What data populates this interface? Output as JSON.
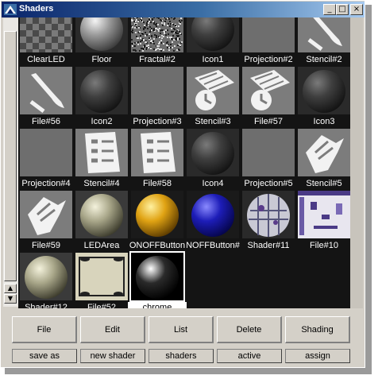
{
  "window": {
    "title": "Shaders"
  },
  "window_controls": {
    "minimize": "_",
    "maximize": "□",
    "close": "×"
  },
  "shaders": [
    {
      "label": "ClearLED",
      "kind": "checker"
    },
    {
      "label": "Floor",
      "kind": "sphere-gray"
    },
    {
      "label": "Fractal#2",
      "kind": "noise"
    },
    {
      "label": "Icon1",
      "kind": "sphere-dark"
    },
    {
      "label": "Projection#2",
      "kind": "flat-gray"
    },
    {
      "label": "Stencil#2",
      "kind": "stencil-pen"
    },
    {
      "label": "File#56",
      "kind": "stencil-pen"
    },
    {
      "label": "Icon2",
      "kind": "sphere-dark"
    },
    {
      "label": "Projection#3",
      "kind": "flat-gray"
    },
    {
      "label": "Stencil#3",
      "kind": "stencil-clock"
    },
    {
      "label": "File#57",
      "kind": "stencil-clock"
    },
    {
      "label": "Icon3",
      "kind": "sphere-dark"
    },
    {
      "label": "Projection#4",
      "kind": "flat-gray"
    },
    {
      "label": "Stencil#4",
      "kind": "stencil-list"
    },
    {
      "label": "File#58",
      "kind": "stencil-list"
    },
    {
      "label": "Icon4",
      "kind": "sphere-dark"
    },
    {
      "label": "Projection#5",
      "kind": "flat-gray"
    },
    {
      "label": "Stencil#5",
      "kind": "stencil-hand"
    },
    {
      "label": "File#59",
      "kind": "stencil-hand"
    },
    {
      "label": "LEDArea",
      "kind": "sphere-cream"
    },
    {
      "label": "ONOFFButton",
      "kind": "sphere-gold"
    },
    {
      "label": "NOFFButton#",
      "kind": "sphere-blue"
    },
    {
      "label": "Shader#11",
      "kind": "sphere-map"
    },
    {
      "label": "File#10",
      "kind": "texture-purple"
    },
    {
      "label": "Shader#12",
      "kind": "sphere-cream"
    },
    {
      "label": "File#52",
      "kind": "texture-frame"
    },
    {
      "label": "chrome",
      "kind": "sphere-chrome",
      "selected": true
    }
  ],
  "menu_buttons": [
    "File",
    "Edit",
    "List",
    "Delete",
    "Shading"
  ],
  "action_buttons": [
    "save as",
    "new shader",
    "shaders",
    "active",
    "assign"
  ]
}
